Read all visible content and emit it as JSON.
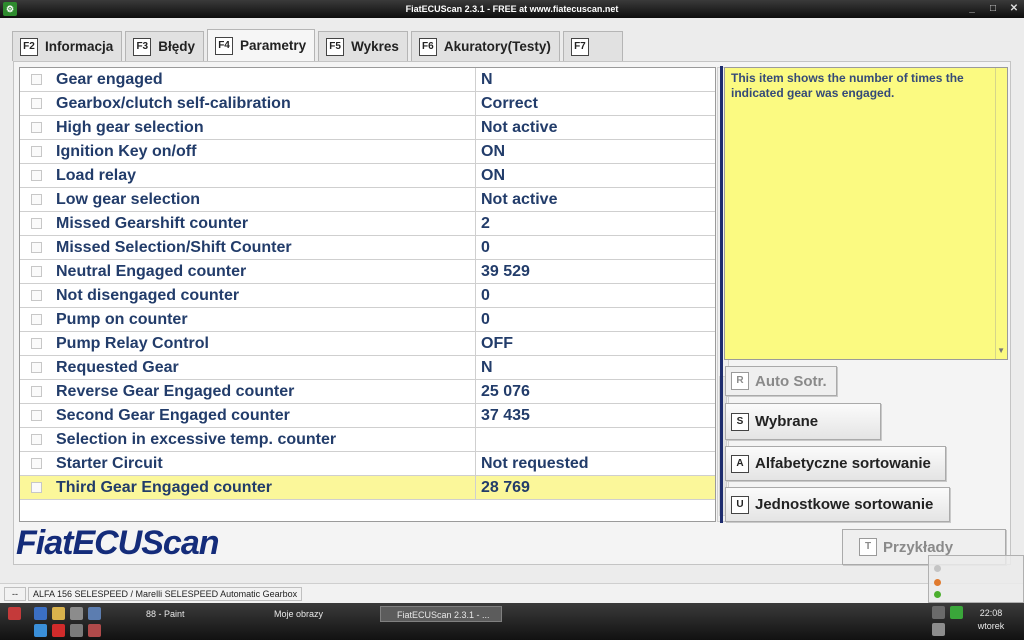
{
  "window": {
    "title": "FiatECUScan 2.3.1 - FREE at www.fiatecuscan.net",
    "controls": [
      "_",
      "□",
      "✕"
    ]
  },
  "tabs": [
    {
      "key": "F2",
      "label": "Informacja"
    },
    {
      "key": "F3",
      "label": "Błędy"
    },
    {
      "key": "F4",
      "label": "Parametry"
    },
    {
      "key": "F5",
      "label": "Wykres"
    },
    {
      "key": "F6",
      "label": "Akuratory(Testy)"
    },
    {
      "key": "F7",
      "label": ""
    }
  ],
  "active_tab": "F4",
  "parameters": [
    {
      "name": "Gear engaged",
      "value": "N"
    },
    {
      "name": "Gearbox/clutch self-calibration",
      "value": "Correct"
    },
    {
      "name": "High gear selection",
      "value": "Not active"
    },
    {
      "name": "Ignition Key on/off",
      "value": "ON"
    },
    {
      "name": "Load relay",
      "value": "ON"
    },
    {
      "name": "Low gear selection",
      "value": "Not active"
    },
    {
      "name": "Missed Gearshift counter",
      "value": "2"
    },
    {
      "name": "Missed Selection/Shift Counter",
      "value": "0"
    },
    {
      "name": "Neutral Engaged counter",
      "value": "39 529"
    },
    {
      "name": "Not disengaged counter",
      "value": "0"
    },
    {
      "name": "Pump on counter",
      "value": "0"
    },
    {
      "name": "Pump Relay Control",
      "value": "OFF"
    },
    {
      "name": "Requested Gear",
      "value": "N"
    },
    {
      "name": "Reverse Gear Engaged counter",
      "value": "25 076"
    },
    {
      "name": "Second Gear Engaged counter",
      "value": "37 435"
    },
    {
      "name": "Selection in excessive temp. counter",
      "value": ""
    },
    {
      "name": "Starter Circuit",
      "value": "Not requested"
    },
    {
      "name": "Third Gear Engaged counter",
      "value": "28 769"
    }
  ],
  "selected_row": 17,
  "info_text": "This item shows the number of times the indicated gear was engaged.",
  "buttons": {
    "auto_sort": {
      "key": "R",
      "label": "Auto Sotr."
    },
    "selected": {
      "key": "S",
      "label": "Wybrane"
    },
    "alpha_sort": {
      "key": "A",
      "label": "Alfabetyczne sortowanie"
    },
    "unit_sort": {
      "key": "U",
      "label": "Jednostkowe sortowanie"
    },
    "examples": {
      "key": "T",
      "label": "Przykłady"
    }
  },
  "logo": "FiatECUScan",
  "status": {
    "left": "--",
    "vehicle": "ALFA 156 SELESPEED / Marelli SELESPEED Automatic Gearbox"
  },
  "taskbar": {
    "tasks": [
      "88 - Paint",
      "Moje obrazy",
      "FiatECUScan 2.3.1 - ..."
    ],
    "time": "22:08",
    "day": "wtorek"
  },
  "colors": {
    "selected_row": "#fbf79a",
    "info_bg": "#fbfa81",
    "text_blue": "#223c6a",
    "logo_blue": "#142c7a"
  }
}
